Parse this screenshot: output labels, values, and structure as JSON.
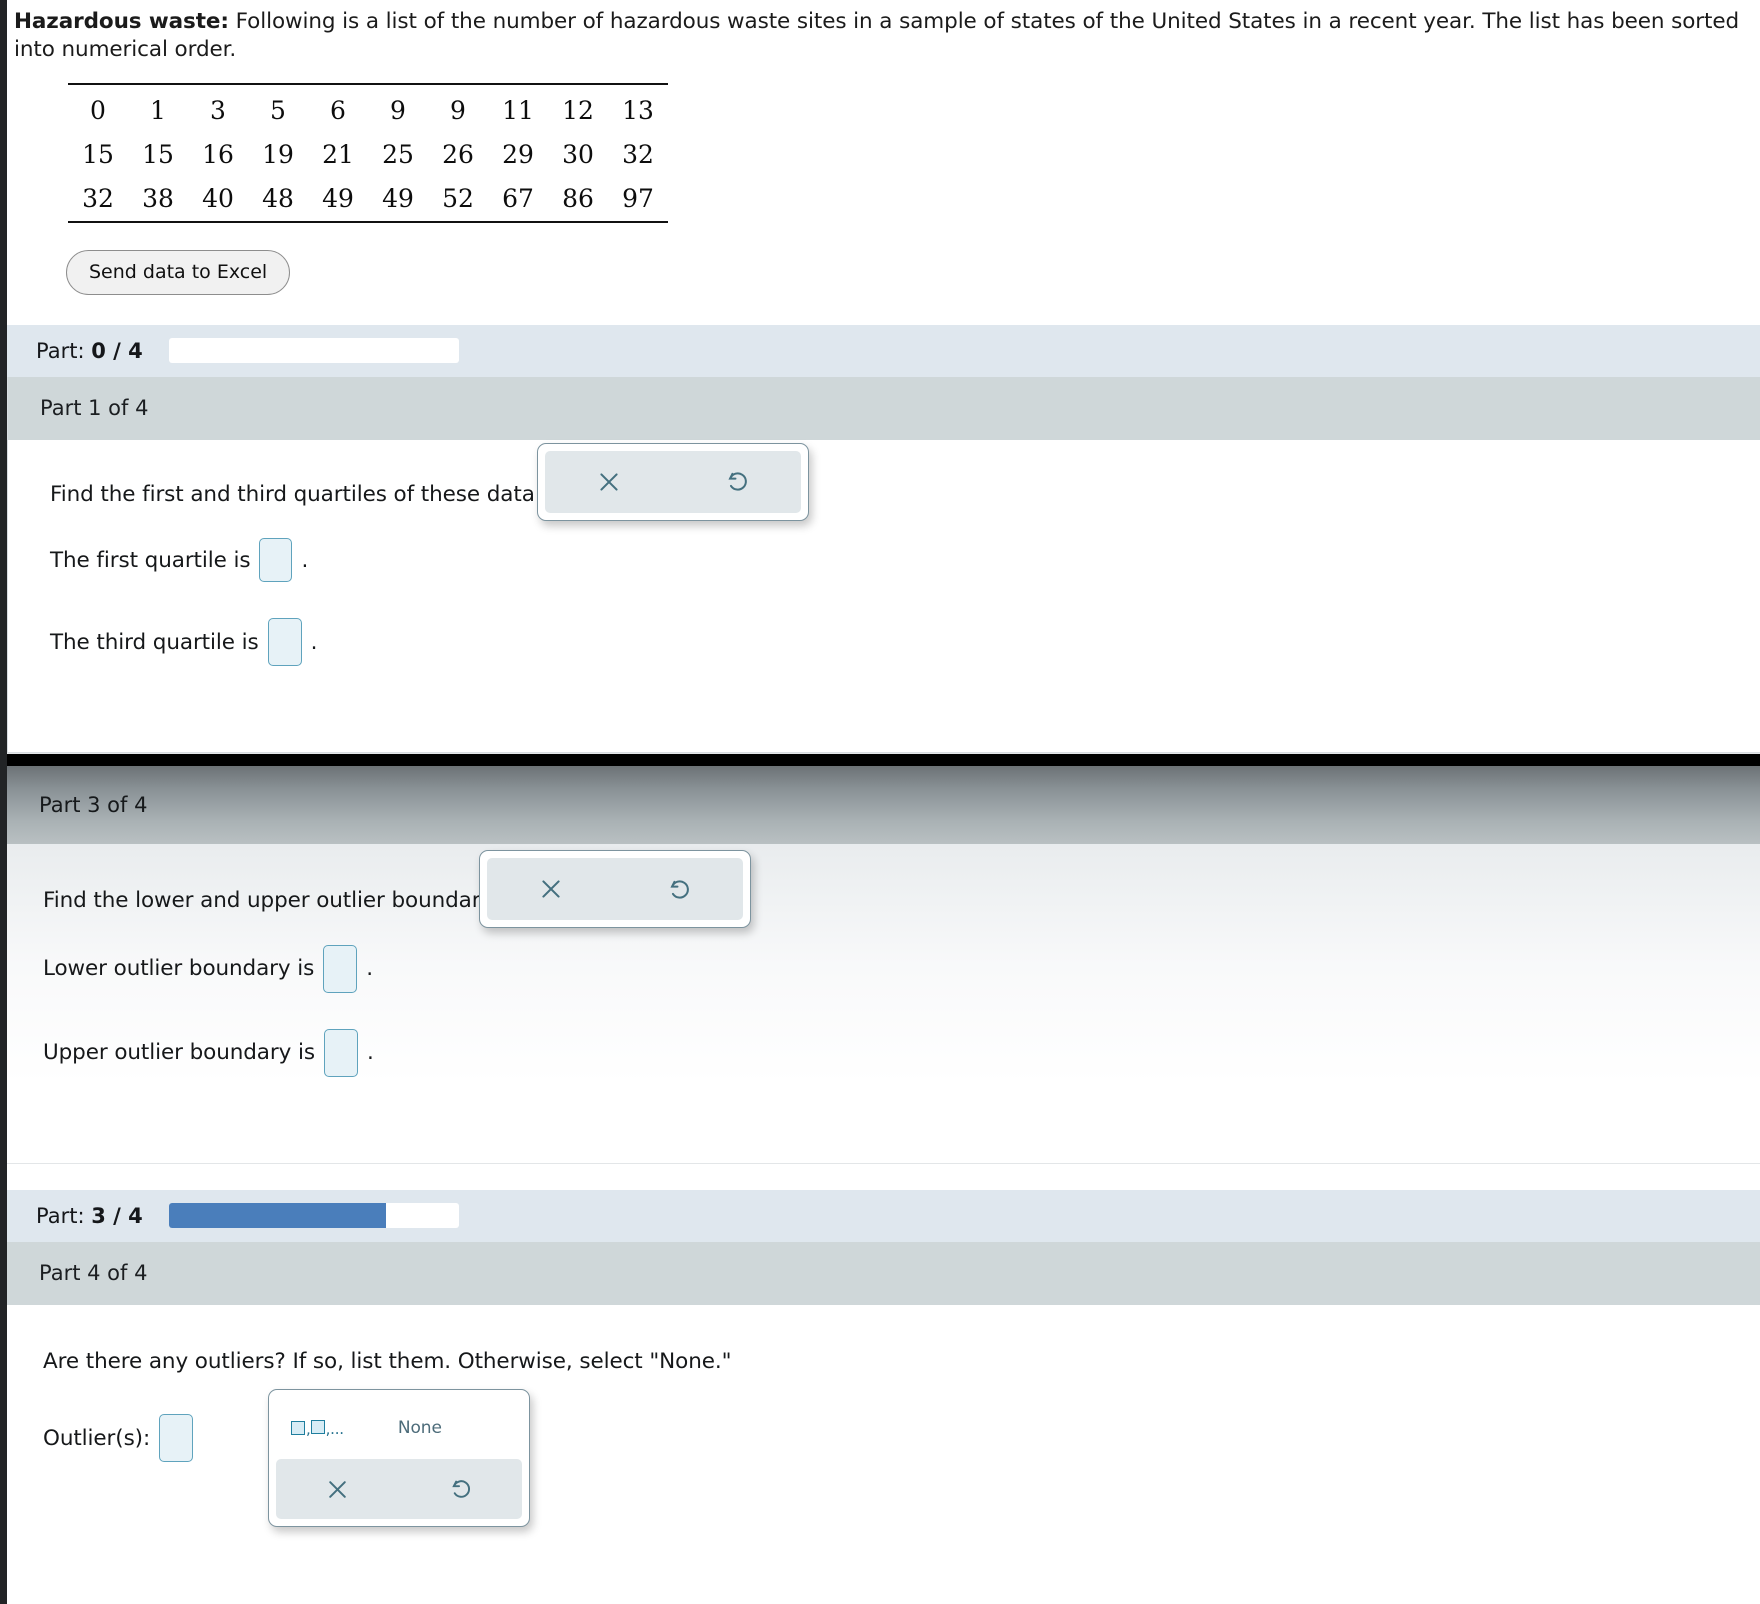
{
  "intro": {
    "title": "Hazardous waste:",
    "text": " Following is a list of the number of hazardous waste sites in a sample of states of the United States in a recent year. The list has been sorted into numerical order."
  },
  "data_table": {
    "rows": [
      [
        "0",
        "1",
        "3",
        "5",
        "6",
        "9",
        "9",
        "11",
        "12",
        "13"
      ],
      [
        "15",
        "15",
        "16",
        "19",
        "21",
        "25",
        "26",
        "29",
        "30",
        "32"
      ],
      [
        "32",
        "38",
        "40",
        "48",
        "49",
        "49",
        "52",
        "67",
        "86",
        "97"
      ]
    ]
  },
  "excel_button": {
    "label": "Send data to Excel"
  },
  "progress_top": {
    "label_prefix": "Part: ",
    "current": "0",
    "separator": " / ",
    "total": "4",
    "percent": 0,
    "fill_color": "#4a7ebb"
  },
  "progress_mid": {
    "label_prefix": "Part: ",
    "current": "3",
    "separator": " / ",
    "total": "4",
    "percent": 75,
    "fill_color": "#4a7ebb"
  },
  "part1": {
    "header": "Part 1 of 4",
    "prompt": "Find the first and third quartiles of these data.",
    "line1_before": "The first quartile is",
    "line1_after": ".",
    "line2_before": "The third quartile is",
    "line2_after": ".",
    "q1_value": "",
    "q3_value": "",
    "toolbar": {
      "clear_label": "clear",
      "undo_label": "undo"
    }
  },
  "part3": {
    "header": "Part 3 of 4",
    "prompt": "Find the lower and upper outlier boundaries.",
    "line1_before": "Lower outlier boundary is",
    "line1_after": ".",
    "line2_before": "Upper outlier boundary is",
    "line2_after": ".",
    "lower_value": "",
    "upper_value": "",
    "toolbar": {
      "clear_label": "clear",
      "undo_label": "undo"
    }
  },
  "part4": {
    "header": "Part 4 of 4",
    "prompt": "Are there any outliers? If so, list them. Otherwise, select \"None.\"",
    "outliers_label": "Outlier(s):",
    "outliers_value": "",
    "list_option": ",,...",
    "none_option": "None",
    "toolbar": {
      "clear_label": "clear",
      "undo_label": "undo"
    }
  },
  "colors": {
    "input_fill": "#e7f2f7",
    "input_border": "#5fa3bd",
    "header_gray": "#cfd7d9",
    "progress_bg": "#dfe7ee",
    "accent_blue": "#4a7ebb"
  }
}
